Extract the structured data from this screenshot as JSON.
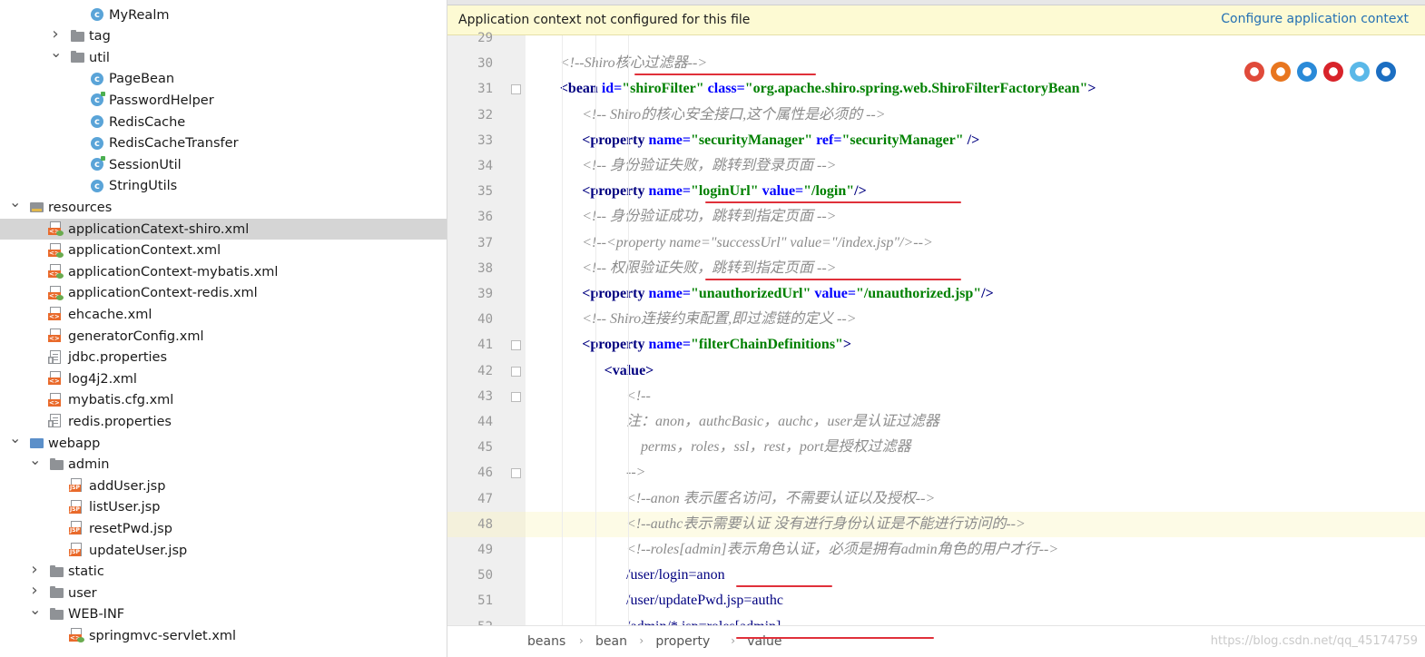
{
  "tree": [
    {
      "label": "MyRealm",
      "icon": "class",
      "indent": 100,
      "arrow": ""
    },
    {
      "label": "tag",
      "icon": "folder",
      "indent": 78,
      "arrow": "right"
    },
    {
      "label": "util",
      "icon": "folder",
      "indent": 78,
      "arrow": "down"
    },
    {
      "label": "PageBean",
      "icon": "class",
      "indent": 100,
      "arrow": ""
    },
    {
      "label": "PasswordHelper",
      "icon": "class-run",
      "indent": 100,
      "arrow": ""
    },
    {
      "label": "RedisCache",
      "icon": "class",
      "indent": 100,
      "arrow": ""
    },
    {
      "label": "RedisCacheTransfer",
      "icon": "class",
      "indent": 100,
      "arrow": ""
    },
    {
      "label": "SessionUtil",
      "icon": "class-run",
      "indent": 100,
      "arrow": ""
    },
    {
      "label": "StringUtils",
      "icon": "class",
      "indent": 100,
      "arrow": ""
    },
    {
      "label": "resources",
      "icon": "folder-res",
      "indent": 33,
      "arrow": "down"
    },
    {
      "label": "applicationCatext-shiro.xml",
      "icon": "xml",
      "indent": 55,
      "arrow": "",
      "selected": true
    },
    {
      "label": "applicationContext.xml",
      "icon": "xml",
      "indent": 55,
      "arrow": ""
    },
    {
      "label": "applicationContext-mybatis.xml",
      "icon": "xml",
      "indent": 55,
      "arrow": ""
    },
    {
      "label": "applicationContext-redis.xml",
      "icon": "xml",
      "indent": 55,
      "arrow": ""
    },
    {
      "label": "ehcache.xml",
      "icon": "xml2",
      "indent": 55,
      "arrow": ""
    },
    {
      "label": "generatorConfig.xml",
      "icon": "xml2",
      "indent": 55,
      "arrow": ""
    },
    {
      "label": "jdbc.properties",
      "icon": "prop",
      "indent": 55,
      "arrow": ""
    },
    {
      "label": "log4j2.xml",
      "icon": "xml2",
      "indent": 55,
      "arrow": ""
    },
    {
      "label": "mybatis.cfg.xml",
      "icon": "xml2",
      "indent": 55,
      "arrow": ""
    },
    {
      "label": "redis.properties",
      "icon": "prop",
      "indent": 55,
      "arrow": ""
    },
    {
      "label": "webapp",
      "icon": "folder-web",
      "indent": 33,
      "arrow": "down"
    },
    {
      "label": "admin",
      "icon": "folder",
      "indent": 55,
      "arrow": "down"
    },
    {
      "label": "addUser.jsp",
      "icon": "jsp",
      "indent": 78,
      "arrow": ""
    },
    {
      "label": "listUser.jsp",
      "icon": "jsp",
      "indent": 78,
      "arrow": ""
    },
    {
      "label": "resetPwd.jsp",
      "icon": "jsp",
      "indent": 78,
      "arrow": ""
    },
    {
      "label": "updateUser.jsp",
      "icon": "jsp",
      "indent": 78,
      "arrow": ""
    },
    {
      "label": "static",
      "icon": "folder",
      "indent": 55,
      "arrow": "right"
    },
    {
      "label": "user",
      "icon": "folder",
      "indent": 55,
      "arrow": "right"
    },
    {
      "label": "WEB-INF",
      "icon": "folder",
      "indent": 55,
      "arrow": "down"
    },
    {
      "label": "springmvc-servlet.xml",
      "icon": "xml",
      "indent": 78,
      "arrow": ""
    }
  ],
  "banner": {
    "message": "Application context not configured for this file",
    "action": "Configure application context"
  },
  "code": [
    {
      "n": "29",
      "segs": []
    },
    {
      "n": "30",
      "segs": [
        {
          "t": "<!--Shiro核心过滤器-->",
          "c": "cm"
        }
      ],
      "ind": 3.1
    },
    {
      "n": "31",
      "segs": [
        {
          "t": "<bean ",
          "c": "tg"
        },
        {
          "t": "id=",
          "c": "at"
        },
        {
          "t": "\"shiroFilter\" ",
          "c": "vl"
        },
        {
          "t": "class=",
          "c": "at"
        },
        {
          "t": "\"org.apache.shiro.spring.web.ShiroFilterFactoryBean\"",
          "c": "vl"
        },
        {
          "t": ">",
          "c": "tg"
        }
      ],
      "ind": 3.1
    },
    {
      "n": "32",
      "segs": [
        {
          "t": "<!-- Shiro的核心安全接口,这个属性是必须的 -->",
          "c": "cm"
        }
      ],
      "ind": 5.1
    },
    {
      "n": "33",
      "segs": [
        {
          "t": "<property ",
          "c": "tg"
        },
        {
          "t": "name=",
          "c": "at"
        },
        {
          "t": "\"securityManager\" ",
          "c": "vl"
        },
        {
          "t": "ref=",
          "c": "at"
        },
        {
          "t": "\"securityManager\" ",
          "c": "vl"
        },
        {
          "t": "/>",
          "c": "tg"
        }
      ],
      "ind": 5.1
    },
    {
      "n": "34",
      "segs": [
        {
          "t": "<!-- 身份验证失败，跳转到登录页面 -->",
          "c": "cm"
        }
      ],
      "ind": 5.1
    },
    {
      "n": "35",
      "segs": [
        {
          "t": "<property ",
          "c": "tg"
        },
        {
          "t": "name=",
          "c": "at"
        },
        {
          "t": "\"loginUrl\" ",
          "c": "vl"
        },
        {
          "t": "value=",
          "c": "at"
        },
        {
          "t": "\"/login\"",
          "c": "vl"
        },
        {
          "t": "/>",
          "c": "tg"
        }
      ],
      "ind": 5.1
    },
    {
      "n": "36",
      "segs": [
        {
          "t": "<!-- 身份验证成功，跳转到指定页面 -->",
          "c": "cm"
        }
      ],
      "ind": 5.1
    },
    {
      "n": "37",
      "segs": [
        {
          "t": "<!--<property name=\"successUrl\" value=\"/index.jsp\"/>-->",
          "c": "cm"
        }
      ],
      "ind": 5.1
    },
    {
      "n": "38",
      "segs": [
        {
          "t": "<!-- 权限验证失败，跳转到指定页面 -->",
          "c": "cm"
        }
      ],
      "ind": 5.1
    },
    {
      "n": "39",
      "segs": [
        {
          "t": "<property ",
          "c": "tg"
        },
        {
          "t": "name=",
          "c": "at"
        },
        {
          "t": "\"unauthorizedUrl\" ",
          "c": "vl"
        },
        {
          "t": "value=",
          "c": "at"
        },
        {
          "t": "\"/unauthorized.jsp\"",
          "c": "vl"
        },
        {
          "t": "/>",
          "c": "tg"
        }
      ],
      "ind": 5.1
    },
    {
      "n": "40",
      "segs": [
        {
          "t": "<!-- Shiro连接约束配置,即过滤链的定义 -->",
          "c": "cm"
        }
      ],
      "ind": 5.1
    },
    {
      "n": "41",
      "segs": [
        {
          "t": "<property ",
          "c": "tg"
        },
        {
          "t": "name=",
          "c": "at"
        },
        {
          "t": "\"filterChainDefinitions\"",
          "c": "vl"
        },
        {
          "t": ">",
          "c": "tg"
        }
      ],
      "ind": 5.1
    },
    {
      "n": "42",
      "segs": [
        {
          "t": "<value>",
          "c": "tg"
        }
      ],
      "ind": 7.1
    },
    {
      "n": "43",
      "segs": [
        {
          "t": "<!--",
          "c": "cm"
        }
      ],
      "ind": 9.1
    },
    {
      "n": "44",
      "segs": [
        {
          "t": "注：anon，authcBasic，auchc，user是认证过滤器",
          "c": "cm"
        }
      ],
      "ind": 9.1
    },
    {
      "n": "45",
      "segs": [
        {
          "t": "    perms，roles，ssl，rest，port是授权过滤器",
          "c": "cm"
        }
      ],
      "ind": 9.1
    },
    {
      "n": "46",
      "segs": [
        {
          "t": "-->",
          "c": "cm"
        }
      ],
      "ind": 9.1
    },
    {
      "n": "47",
      "segs": [
        {
          "t": "<!--anon 表示匿名访问，不需要认证以及授权-->",
          "c": "cm"
        }
      ],
      "ind": 9.1
    },
    {
      "n": "48",
      "segs": [
        {
          "t": "<!--authc表示需要认证 没有进行身份认证是不能进行访问的-->",
          "c": "cm"
        }
      ],
      "ind": 9.1,
      "hl": true
    },
    {
      "n": "49",
      "segs": [
        {
          "t": "<!--roles[admin]表示角色认证，必须是拥有admin角色的用户才行-->",
          "c": "cm"
        }
      ],
      "ind": 9.1
    },
    {
      "n": "50",
      "segs": [
        {
          "t": "/user/login=anon",
          "c": "pl"
        }
      ],
      "ind": 9.1
    },
    {
      "n": "51",
      "segs": [
        {
          "t": "/user/updatePwd.jsp=authc",
          "c": "pl"
        }
      ],
      "ind": 9.1
    },
    {
      "n": "52",
      "segs": [
        {
          "t": "/admin/*.jsp=roles[admin]",
          "c": "pl"
        }
      ],
      "ind": 9.1
    }
  ],
  "breadcrumb": [
    "beans",
    "bean",
    "property",
    "value"
  ],
  "watermark": "https://blog.csdn.net/qq_45174759",
  "browsers": [
    {
      "name": "chrome-icon",
      "color": "#e04a3a"
    },
    {
      "name": "firefox-icon",
      "color": "#e8761f"
    },
    {
      "name": "safari-icon",
      "color": "#2a8ad8"
    },
    {
      "name": "opera-icon",
      "color": "#d8232a"
    },
    {
      "name": "ie-icon",
      "color": "#5ab8e8"
    },
    {
      "name": "edge-icon",
      "color": "#1b6ec2"
    }
  ]
}
